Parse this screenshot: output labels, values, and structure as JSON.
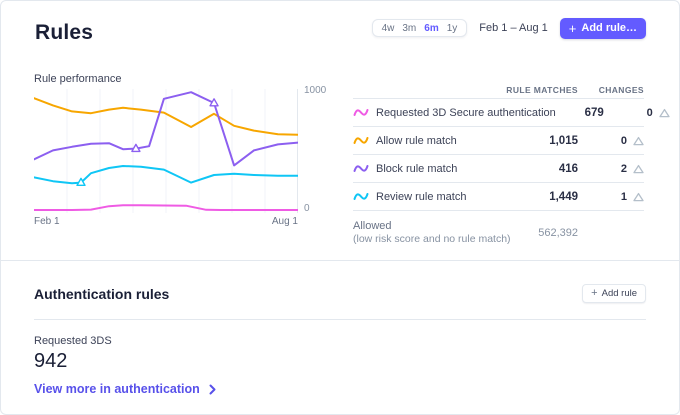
{
  "page": {
    "title": "Rules",
    "date_range": "Feb 1 – Aug 1",
    "add_rule_label": "Add rule…",
    "range_options": [
      "4w",
      "3m",
      "6m",
      "1y"
    ],
    "range_selected": "6m"
  },
  "colors": {
    "accent": "#635bff",
    "link": "#5851ea",
    "border": "#e3e8ee",
    "grid": "#f0f3f8",
    "triangle_icon": "#b4bfca",
    "series_pink": "#ef5be4",
    "series_orange": "#f7a600",
    "series_purple": "#8c5ff0",
    "series_cyan": "#0fc6f5"
  },
  "chart_data": {
    "type": "line",
    "title": "Rule performance",
    "x_axis": {
      "start_label": "Feb 1",
      "end_label": "Aug 1"
    },
    "y_axis": {
      "min": 0,
      "max": 1000,
      "tick_labels": [
        "0",
        "1000"
      ]
    },
    "grid": {
      "vertical_divisions": 8
    },
    "legend_position": "right-table",
    "series": [
      {
        "name": "Allow rule match",
        "color": "#f7a600",
        "points": [
          [
            0,
            940
          ],
          [
            0.072,
            880
          ],
          [
            0.144,
            830
          ],
          [
            0.216,
            815
          ],
          [
            0.284,
            845
          ],
          [
            0.337,
            860
          ],
          [
            0.405,
            845
          ],
          [
            0.492,
            820
          ],
          [
            0.595,
            700
          ],
          [
            0.682,
            810
          ],
          [
            0.758,
            710
          ],
          [
            0.833,
            670
          ],
          [
            0.924,
            640
          ],
          [
            1,
            635
          ]
        ],
        "change_markers": []
      },
      {
        "name": "Block rule match",
        "color": "#8c5ff0",
        "points": [
          [
            0,
            430
          ],
          [
            0.072,
            505
          ],
          [
            0.144,
            535
          ],
          [
            0.216,
            560
          ],
          [
            0.284,
            565
          ],
          [
            0.337,
            515
          ],
          [
            0.386,
            520
          ],
          [
            0.436,
            540
          ],
          [
            0.492,
            935
          ],
          [
            0.595,
            990
          ],
          [
            0.682,
            900
          ],
          [
            0.758,
            380
          ],
          [
            0.833,
            505
          ],
          [
            0.924,
            555
          ],
          [
            1,
            570
          ]
        ],
        "change_markers": [
          [
            0.386,
            520
          ],
          [
            0.682,
            900
          ]
        ]
      },
      {
        "name": "Review rule match",
        "color": "#0fc6f5",
        "points": [
          [
            0,
            280
          ],
          [
            0.072,
            248
          ],
          [
            0.144,
            232
          ],
          [
            0.178,
            237
          ],
          [
            0.216,
            315
          ],
          [
            0.284,
            358
          ],
          [
            0.337,
            375
          ],
          [
            0.405,
            368
          ],
          [
            0.492,
            345
          ],
          [
            0.595,
            237
          ],
          [
            0.682,
            300
          ],
          [
            0.758,
            310
          ],
          [
            0.833,
            300
          ],
          [
            0.924,
            293
          ],
          [
            1,
            293
          ]
        ],
        "change_markers": [
          [
            0.178,
            237
          ]
        ]
      },
      {
        "name": "Requested 3D Secure authentication",
        "color": "#ef5be4",
        "points": [
          [
            0,
            8
          ],
          [
            0.144,
            8
          ],
          [
            0.216,
            12
          ],
          [
            0.284,
            40
          ],
          [
            0.337,
            48
          ],
          [
            0.405,
            48
          ],
          [
            0.492,
            46
          ],
          [
            0.576,
            44
          ],
          [
            0.652,
            10
          ],
          [
            0.708,
            8
          ],
          [
            1,
            8
          ]
        ],
        "change_markers": []
      }
    ]
  },
  "table": {
    "columns": [
      "RULE MATCHES",
      "CHANGES"
    ],
    "rows": [
      {
        "label": "Requested 3D Secure authentication",
        "color": "#ef5be4",
        "matches": "679",
        "changes": "0"
      },
      {
        "label": "Allow rule match",
        "color": "#f7a600",
        "matches": "1,015",
        "changes": "0"
      },
      {
        "label": "Block rule match",
        "color": "#8c5ff0",
        "matches": "416",
        "changes": "2"
      },
      {
        "label": "Review rule match",
        "color": "#0fc6f5",
        "matches": "1,449",
        "changes": "1"
      }
    ],
    "summary_row": {
      "label": "Allowed",
      "sublabel": "(low risk score and no rule match)",
      "value": "562,392"
    }
  },
  "auth_section": {
    "title": "Authentication rules",
    "add_rule_label": "Add rule",
    "metric_label": "Requested 3DS",
    "metric_value": "942",
    "link_label": "View more in authentication"
  }
}
